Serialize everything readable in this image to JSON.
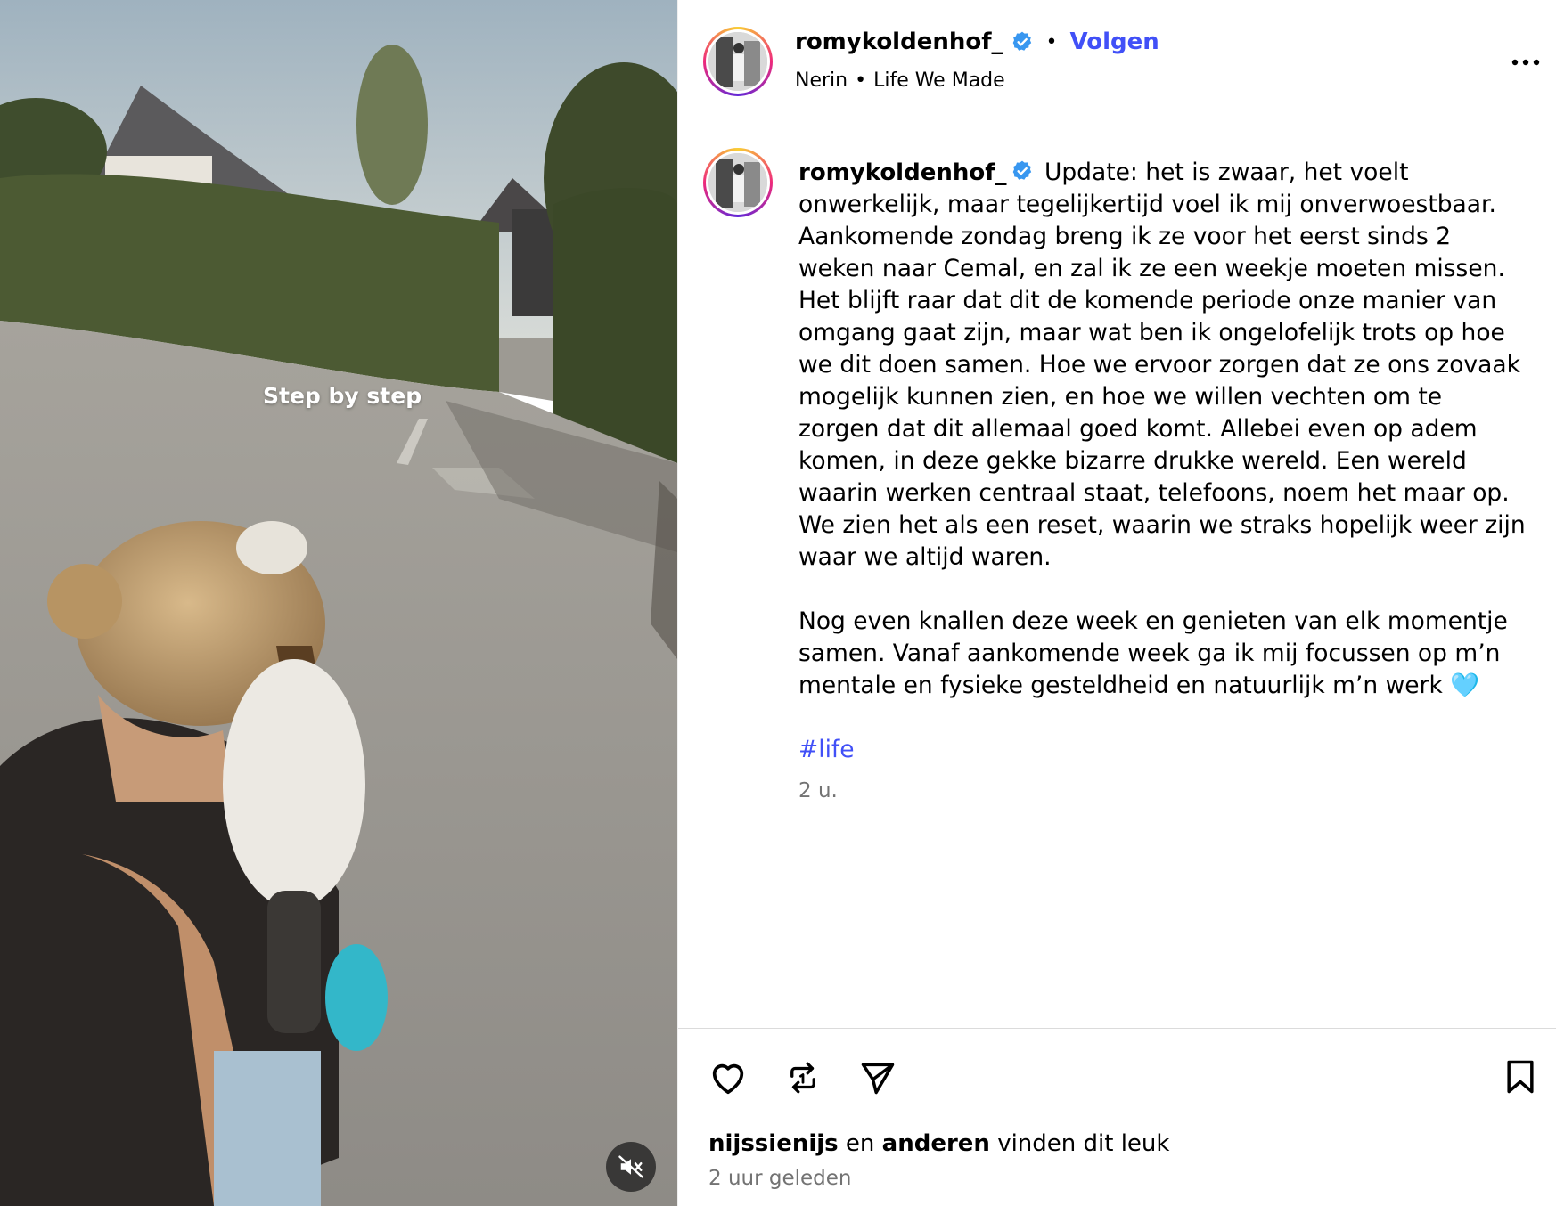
{
  "media": {
    "overlay_text": "Step by step",
    "mute_icon": "speaker-muted-icon"
  },
  "header": {
    "username": "romykoldenhof_",
    "verified_icon": "verified-badge-icon",
    "separator": "•",
    "follow_label": "Volgen",
    "audio_artist": "Nerin",
    "audio_separator": "•",
    "audio_title": "Life We Made",
    "more_icon": "more-options-icon"
  },
  "caption": {
    "username": "romykoldenhof_",
    "paragraph1": "Update: het is zwaar, het voelt onwerkelijk, maar tegelijkertijd voel ik mij onverwoestbaar. Aankomende zondag breng ik ze voor het eerst sinds 2 weken naar Cemal, en zal ik ze een weekje moeten missen. Het blijft raar dat dit de komende periode onze manier van omgang gaat zijn, maar wat ben ik ongelofelijk trots op hoe we dit doen samen. Hoe we ervoor zorgen dat ze ons zovaak mogelijk kunnen zien, en hoe we willen vechten om te zorgen dat dit allemaal goed komt. Allebei even op adem komen, in deze gekke bizarre drukke wereld. Een wereld waarin werken centraal staat, telefoons, noem het maar op. We zien het als een reset, waarin we straks hopelijk weer zijn waar we altijd waren.",
    "paragraph2": "Nog even knallen deze week en genieten van elk momentje samen. Vanaf aankomende week ga ik mij focussen op m’n mentale en fysieke gesteldheid en natuurlijk m’n werk 🩵",
    "hashtag": "#life",
    "time": "2 u."
  },
  "footer": {
    "like_icon": "heart-icon",
    "repost_icon": "repost-icon",
    "share_icon": "send-icon",
    "save_icon": "bookmark-icon",
    "likes_user": "nijssienijs",
    "likes_and": "en",
    "likes_others": "anderen",
    "likes_suffix": "vinden dit leuk",
    "posted": "2 uur geleden"
  },
  "colors": {
    "accent": "#4150f7",
    "verified": "#3897f0",
    "muted_text": "#737373",
    "divider": "#dbdbdb"
  }
}
